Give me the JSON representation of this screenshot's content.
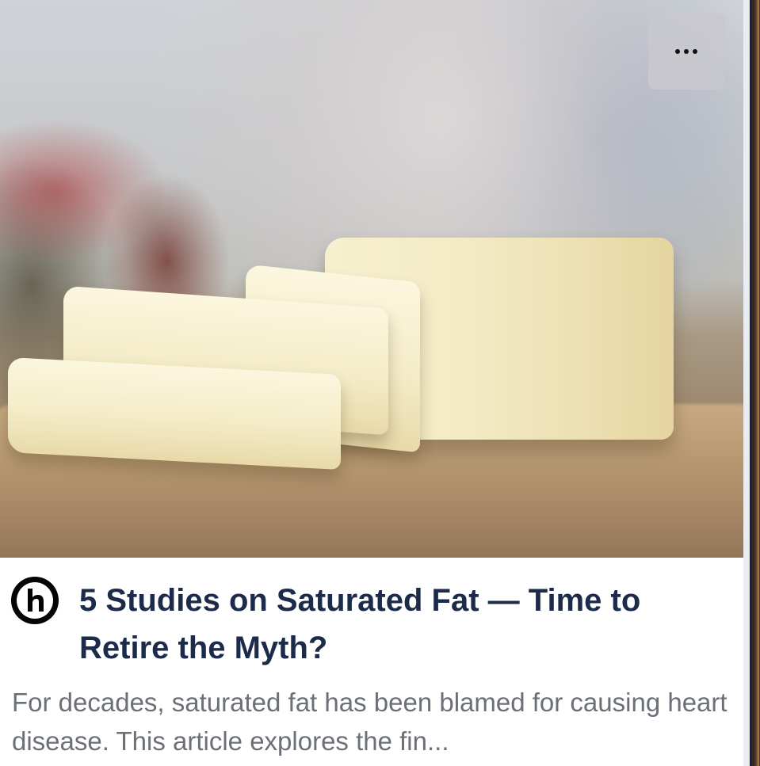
{
  "card": {
    "menu_icon": "more-horizontal-icon",
    "publisher_icon": "publisher-logo-h-icon",
    "title": "5 Studies on Saturated Fat — Time to Retire the Myth?",
    "description": "For decades, saturated fat has been blamed for causing heart disease. This article explores the fin...",
    "colors": {
      "title": "#1c2b4a",
      "description": "#6b6f76",
      "menu_background": "#c8c8cd"
    }
  }
}
